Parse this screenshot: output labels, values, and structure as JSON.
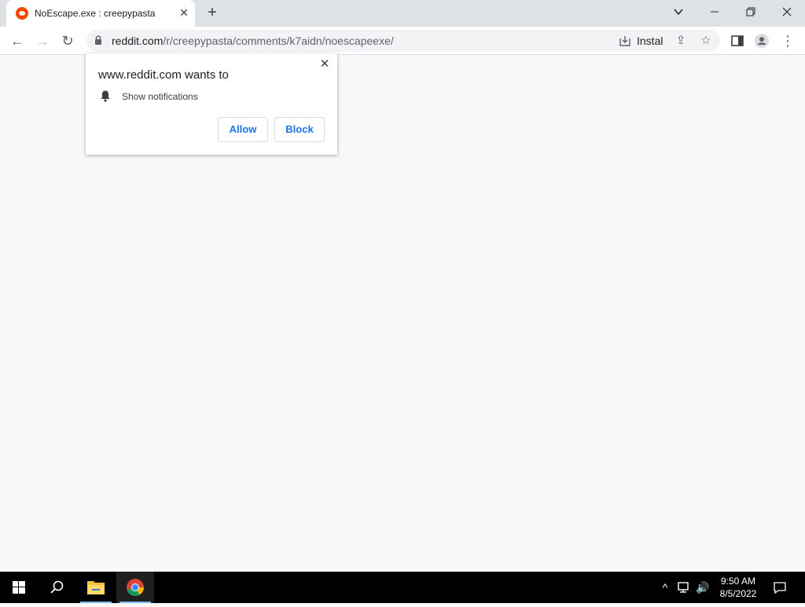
{
  "browser": {
    "tab": {
      "favicon": "reddit-icon",
      "title": "NoEscape.exe : creepypasta",
      "close_glyph": "✕"
    },
    "new_tab_glyph": "+",
    "window_controls": {
      "tab_search_glyph": "⌄",
      "minimize_glyph": "—",
      "restore_glyph": "❐",
      "close_glyph": "✕"
    },
    "toolbar": {
      "back_glyph": "←",
      "forward_glyph": "→",
      "reload_glyph": "↻",
      "url_host": "reddit.com",
      "url_path": "/r/creepypasta/comments/k7aidn/noescapeexe/",
      "install_label": "Instal",
      "share_glyph": "⇪",
      "bookmark_glyph": "☆",
      "menu_glyph": "⋮"
    }
  },
  "permission_popup": {
    "title": "www.reddit.com wants to",
    "permission": "Show notifications",
    "allow_label": "Allow",
    "block_label": "Block",
    "close_glyph": "✕",
    "accent_color": "#1a73e8"
  },
  "taskbar": {
    "clock_time": "9:50 AM",
    "clock_date": "8/5/2022",
    "tray_chevron_glyph": "^",
    "volume_glyph": "🔊"
  }
}
